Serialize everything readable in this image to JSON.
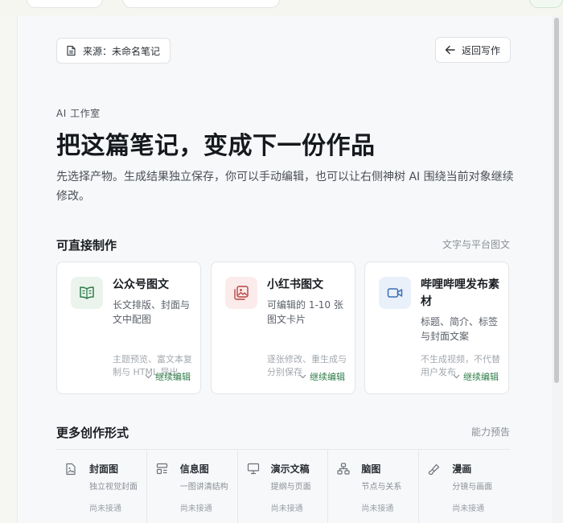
{
  "source_button": {
    "label": "来源：未命名笔记",
    "icon": "document-icon"
  },
  "back_button": {
    "label": "返回写作",
    "icon": "arrow-left-icon"
  },
  "hero": {
    "eyebrow": "AI 工作室",
    "title": "把这篇笔记，变成下一份作品",
    "lead": "先选择产物。生成结果独立保存，你可以手动编辑，也可以让右侧神树 AI 围绕当前对象继续修改。"
  },
  "direct_section": {
    "title": "可直接制作",
    "note": "文字与平台图文",
    "cards": [
      {
        "title": "公众号图文",
        "desc": "长文排版、封面与文中配图",
        "foot": "主题预览、富文本复制与 HTML 导出",
        "action": "继续编辑",
        "icon": "book-open-icon",
        "icon_color": "#2f7d4a",
        "icon_bg": "#eaf4ec"
      },
      {
        "title": "小红书图文",
        "desc": "可编辑的 1-10 张图文卡片",
        "foot": "逐张修改、重生成与分别保存",
        "action": "继续编辑",
        "icon": "image-stack-icon",
        "icon_color": "#b8433f",
        "icon_bg": "#fbeceb"
      },
      {
        "title": "哔哩哔哩发布素材",
        "desc": "标题、简介、标签与封面文案",
        "foot": "不生成视频，不代替用户发布",
        "action": "继续编辑",
        "icon": "video-camera-icon",
        "icon_color": "#3c6fb8",
        "icon_bg": "#e9f0fa"
      }
    ]
  },
  "more_section": {
    "title": "更多创作形式",
    "note": "能力预告",
    "items": [
      {
        "name": "封面图",
        "sub": "独立视觉封面",
        "status": "尚未接通",
        "icon": "image-file-icon"
      },
      {
        "name": "信息图",
        "sub": "一图讲清结构",
        "status": "尚未接通",
        "icon": "layout-icon"
      },
      {
        "name": "演示文稿",
        "sub": "提纲与页面",
        "status": "尚未接通",
        "icon": "presentation-icon"
      },
      {
        "name": "脑图",
        "sub": "节点与关系",
        "status": "尚未接通",
        "icon": "hierarchy-icon"
      },
      {
        "name": "漫画",
        "sub": "分镜与画面",
        "status": "尚未接通",
        "icon": "brush-icon"
      }
    ]
  },
  "colors": {
    "accent": "#2f7d4a",
    "panel_bg": "#f7f8fa"
  }
}
